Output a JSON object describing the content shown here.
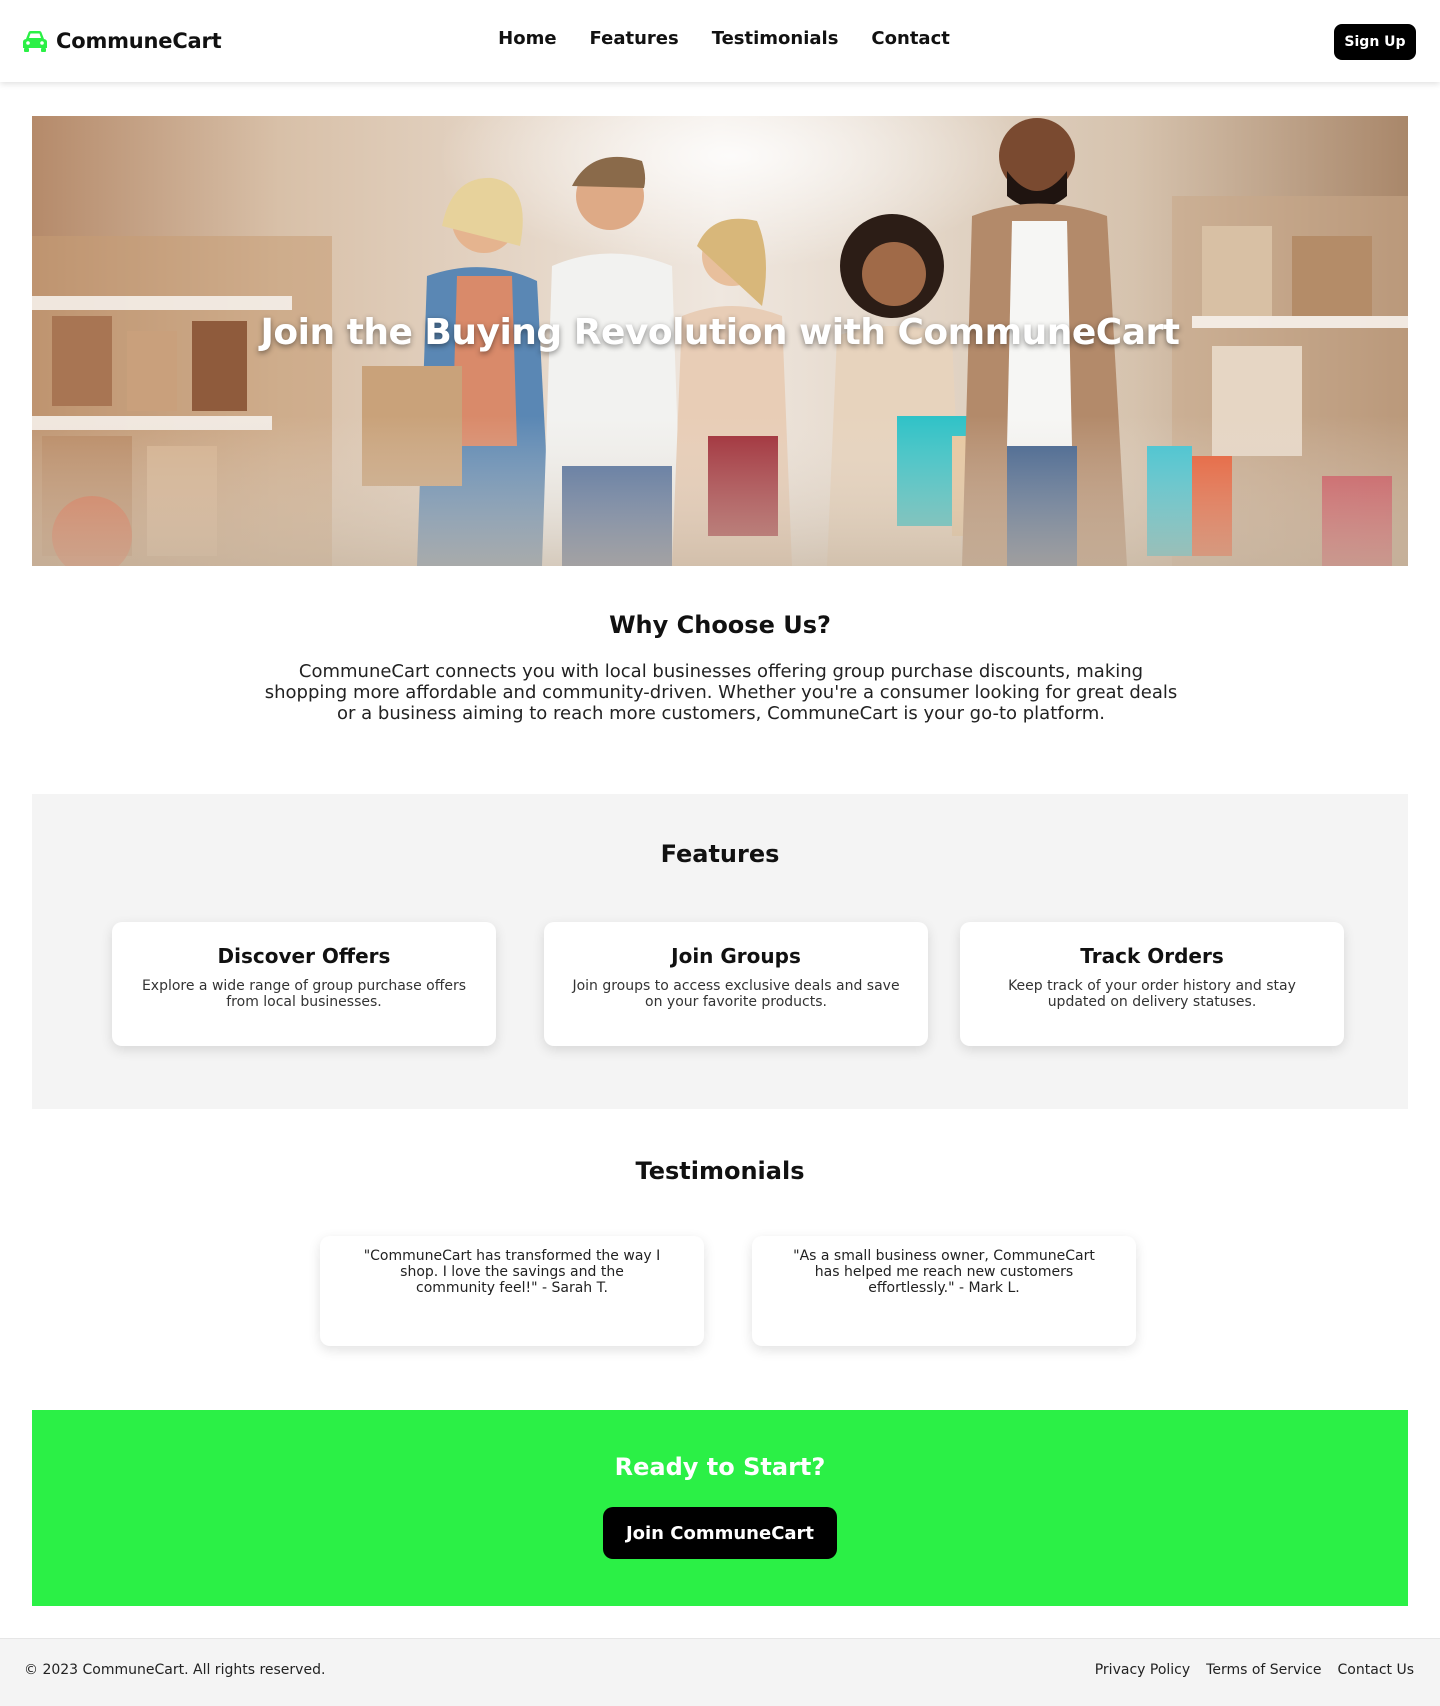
{
  "header": {
    "brand": "CommuneCart",
    "brand_icon": "car-icon",
    "brand_icon_color": "#2bf046",
    "nav": [
      "Home",
      "Features",
      "Testimonials",
      "Contact"
    ],
    "signup_label": "Sign Up"
  },
  "hero": {
    "title": "Join the Buying Revolution with CommuneCart"
  },
  "why": {
    "title": "Why Choose Us?",
    "text": "CommuneCart connects you with local businesses offering group purchase discounts, making shopping more affordable and community-driven. Whether you're a consumer looking for great deals or a business aiming to reach more customers, CommuneCart is your go-to platform."
  },
  "features": {
    "title": "Features",
    "cards": [
      {
        "title": "Discover Offers",
        "text": "Explore a wide range of group purchase offers from local businesses."
      },
      {
        "title": "Join Groups",
        "text": "Join groups to access exclusive deals and save on your favorite products."
      },
      {
        "title": "Track Orders",
        "text": "Keep track of your order history and stay updated on delivery statuses."
      }
    ]
  },
  "testimonials": {
    "title": "Testimonials",
    "items": [
      "\"CommuneCart has transformed the way I shop. I love the savings and the community feel!\" - Sarah T.",
      "\"As a small business owner, CommuneCart has helped me reach new customers effortlessly.\" - Mark L."
    ]
  },
  "cta": {
    "title": "Ready to Start?",
    "button": "Join CommuneCart",
    "color": "#2bf046"
  },
  "footer": {
    "copyright": "© 2023 CommuneCart. All rights reserved.",
    "links": [
      "Privacy Policy",
      "Terms of Service",
      "Contact Us"
    ]
  }
}
